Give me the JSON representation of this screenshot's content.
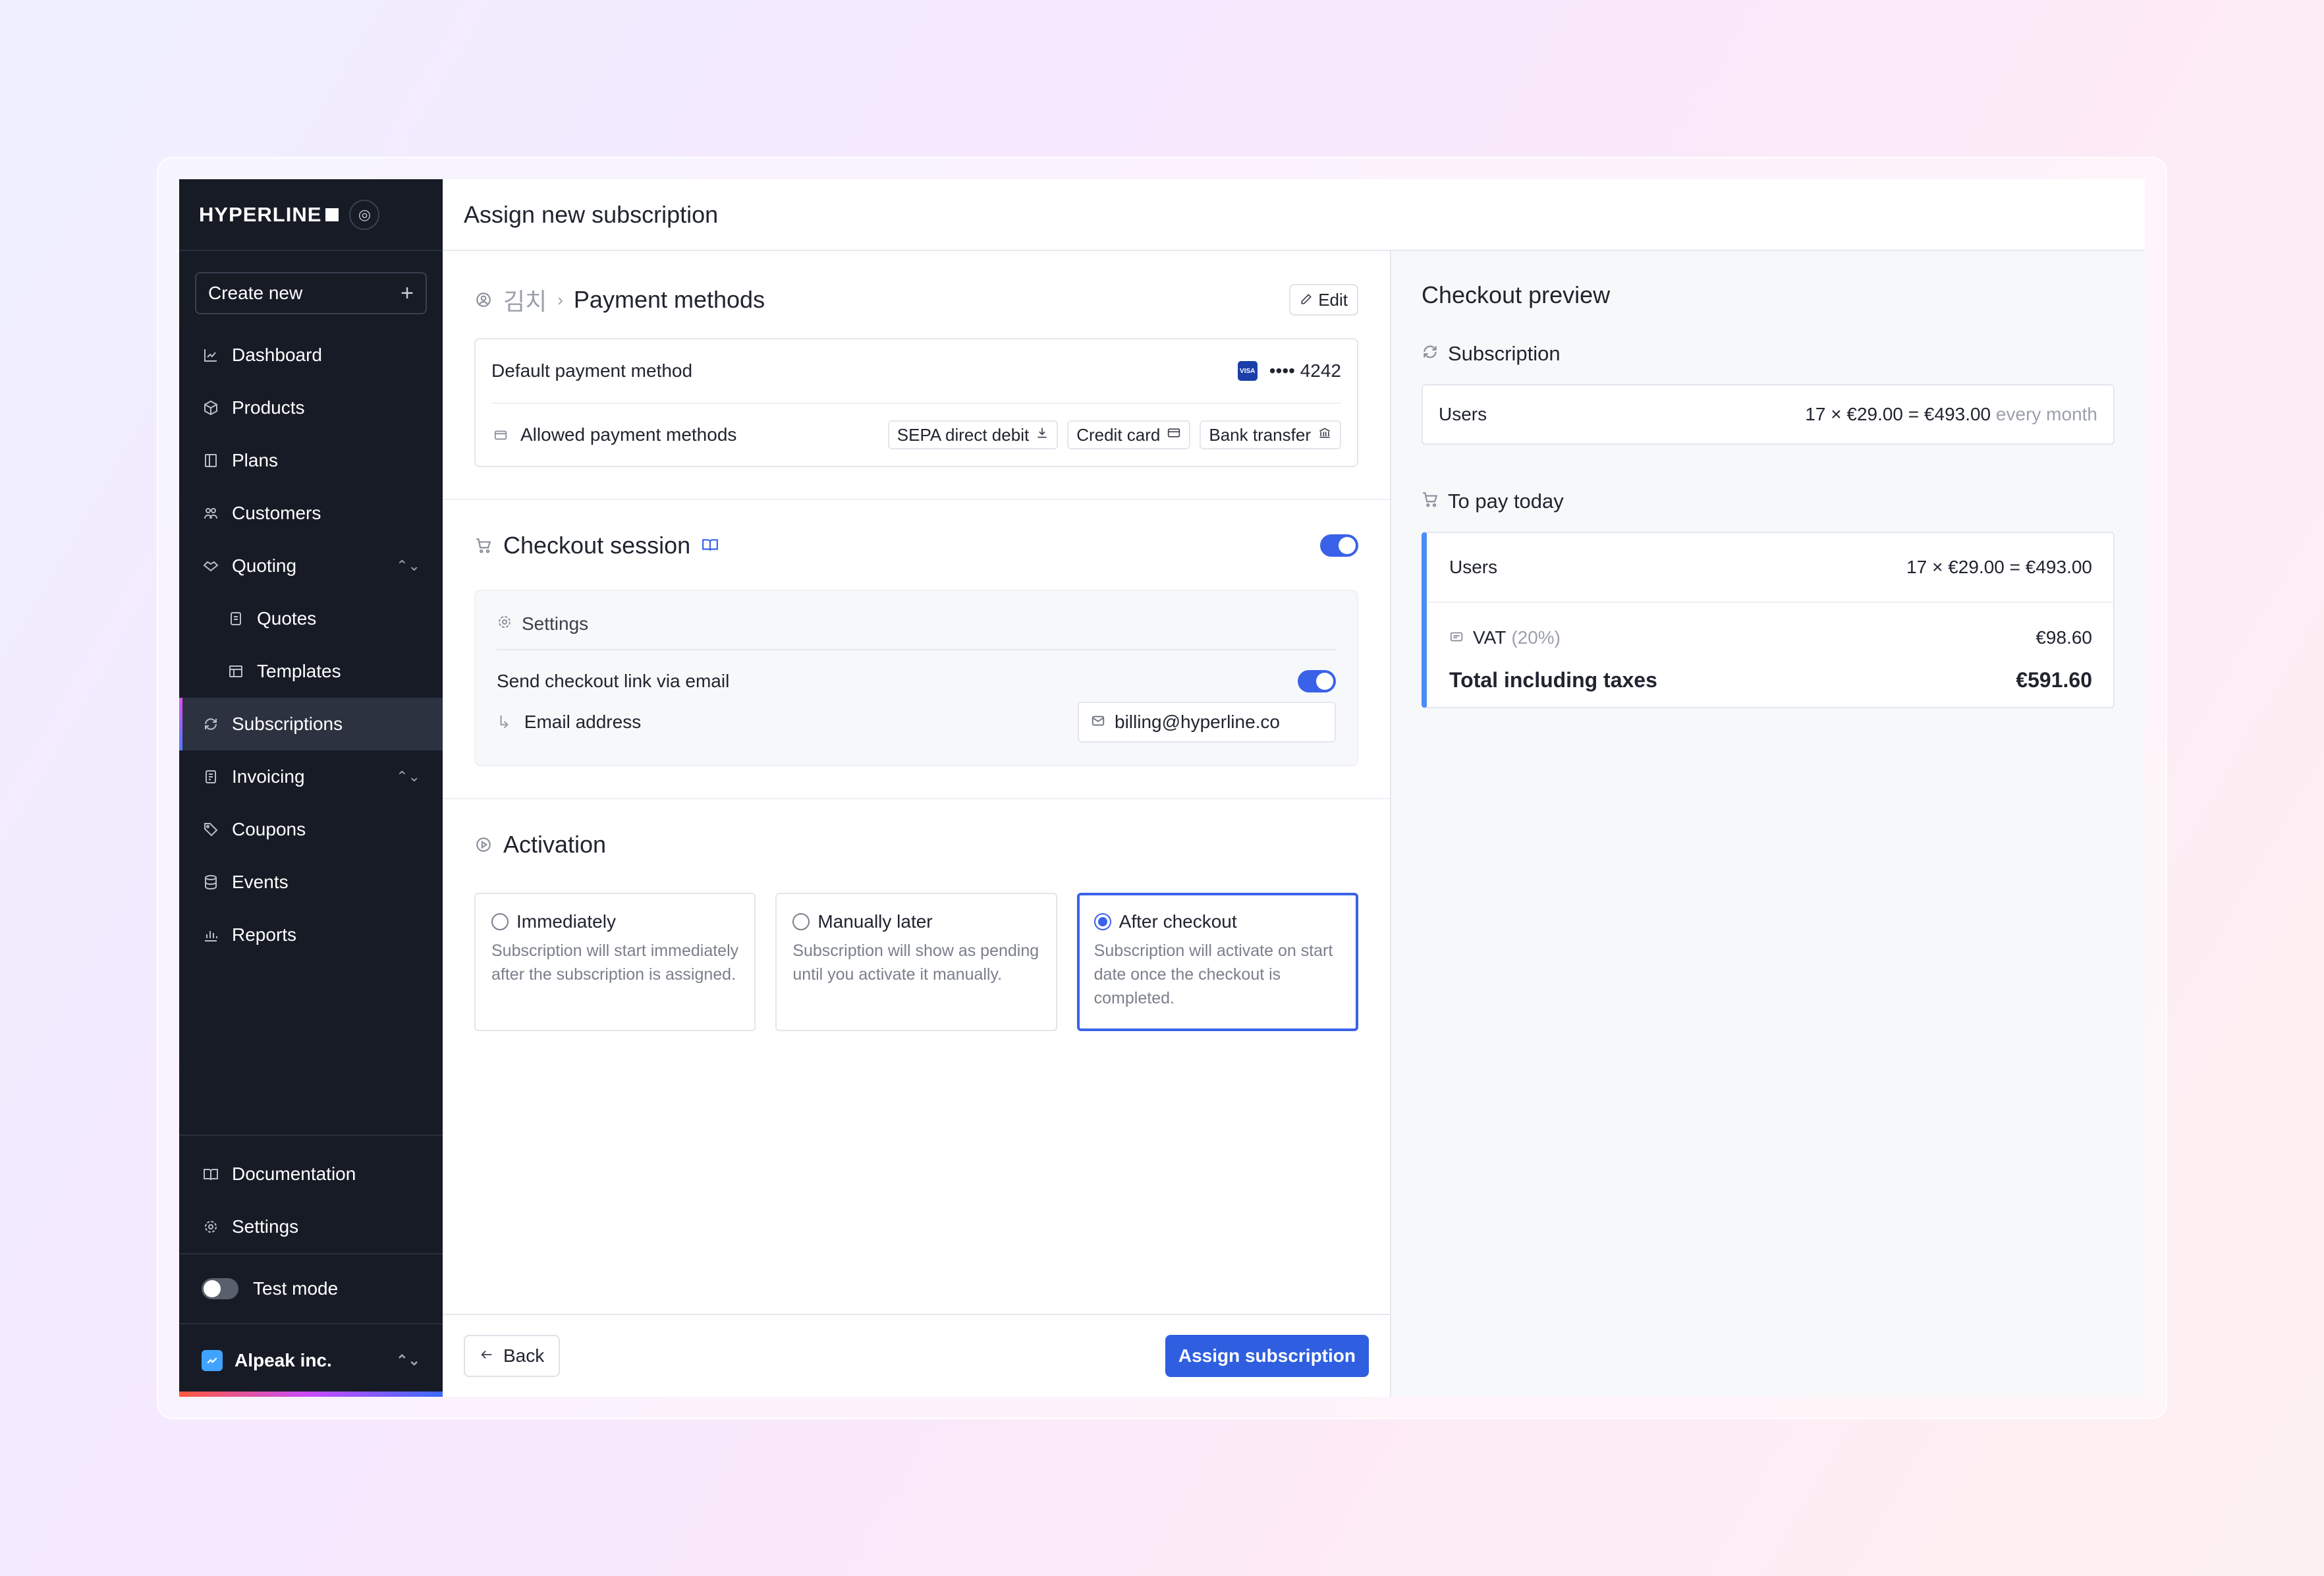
{
  "brand": {
    "name": "HYPERLINE",
    "badge_icon": "target-icon"
  },
  "sidebar": {
    "create_new": "Create new",
    "items": [
      {
        "label": "Dashboard",
        "icon": "chart-icon"
      },
      {
        "label": "Products",
        "icon": "box-icon"
      },
      {
        "label": "Plans",
        "icon": "book-icon"
      },
      {
        "label": "Customers",
        "icon": "users-icon"
      },
      {
        "label": "Quoting",
        "icon": "handshake-icon"
      },
      {
        "label": "Quotes",
        "icon": "document-icon"
      },
      {
        "label": "Templates",
        "icon": "layout-icon"
      },
      {
        "label": "Subscriptions",
        "icon": "refresh-icon"
      },
      {
        "label": "Invoicing",
        "icon": "invoice-icon"
      },
      {
        "label": "Coupons",
        "icon": "tag-icon"
      },
      {
        "label": "Events",
        "icon": "database-icon"
      },
      {
        "label": "Reports",
        "icon": "bar-chart-icon"
      }
    ],
    "bottom": [
      {
        "label": "Documentation",
        "icon": "book-open-icon"
      },
      {
        "label": "Settings",
        "icon": "gear-icon"
      }
    ],
    "test_mode": "Test mode",
    "org": "Alpeak inc."
  },
  "page": {
    "title": "Assign new subscription"
  },
  "payment": {
    "customer": "김치",
    "title": "Payment methods",
    "edit": "Edit",
    "default_label": "Default payment method",
    "card": "•••• 4242",
    "allowed_label": "Allowed payment methods",
    "methods": [
      "SEPA direct debit",
      "Credit card",
      "Bank transfer"
    ]
  },
  "checkout": {
    "title": "Checkout session",
    "enabled": true,
    "settings_label": "Settings",
    "send_link": "Send checkout link via email",
    "send_link_enabled": true,
    "email_label": "Email address",
    "email_value": "billing@hyperline.co"
  },
  "activation": {
    "title": "Activation",
    "options": [
      {
        "label": "Immediately",
        "desc": "Subscription will start immediately after the subscription is assigned.",
        "selected": false
      },
      {
        "label": "Manually later",
        "desc": "Subscription will show as pending until you activate it manually.",
        "selected": false
      },
      {
        "label": "After checkout",
        "desc": "Subscription will activate on start date once the checkout is completed.",
        "selected": true
      }
    ]
  },
  "footer": {
    "back": "Back",
    "assign": "Assign subscription"
  },
  "preview": {
    "title": "Checkout preview",
    "subscription_label": "Subscription",
    "sub_row": {
      "name": "Users",
      "calc": "17 × €29.00 = €493.00",
      "period": "every month"
    },
    "today_label": "To pay today",
    "today_row": {
      "name": "Users",
      "calc": "17 × €29.00 = €493.00"
    },
    "vat_label": "VAT",
    "vat_rate": "(20%)",
    "vat_value": "€98.60",
    "total_label": "Total including taxes",
    "total_value": "€591.60"
  },
  "colors": {
    "accent": "#2f5fe0",
    "sidebar": "#171b26"
  }
}
